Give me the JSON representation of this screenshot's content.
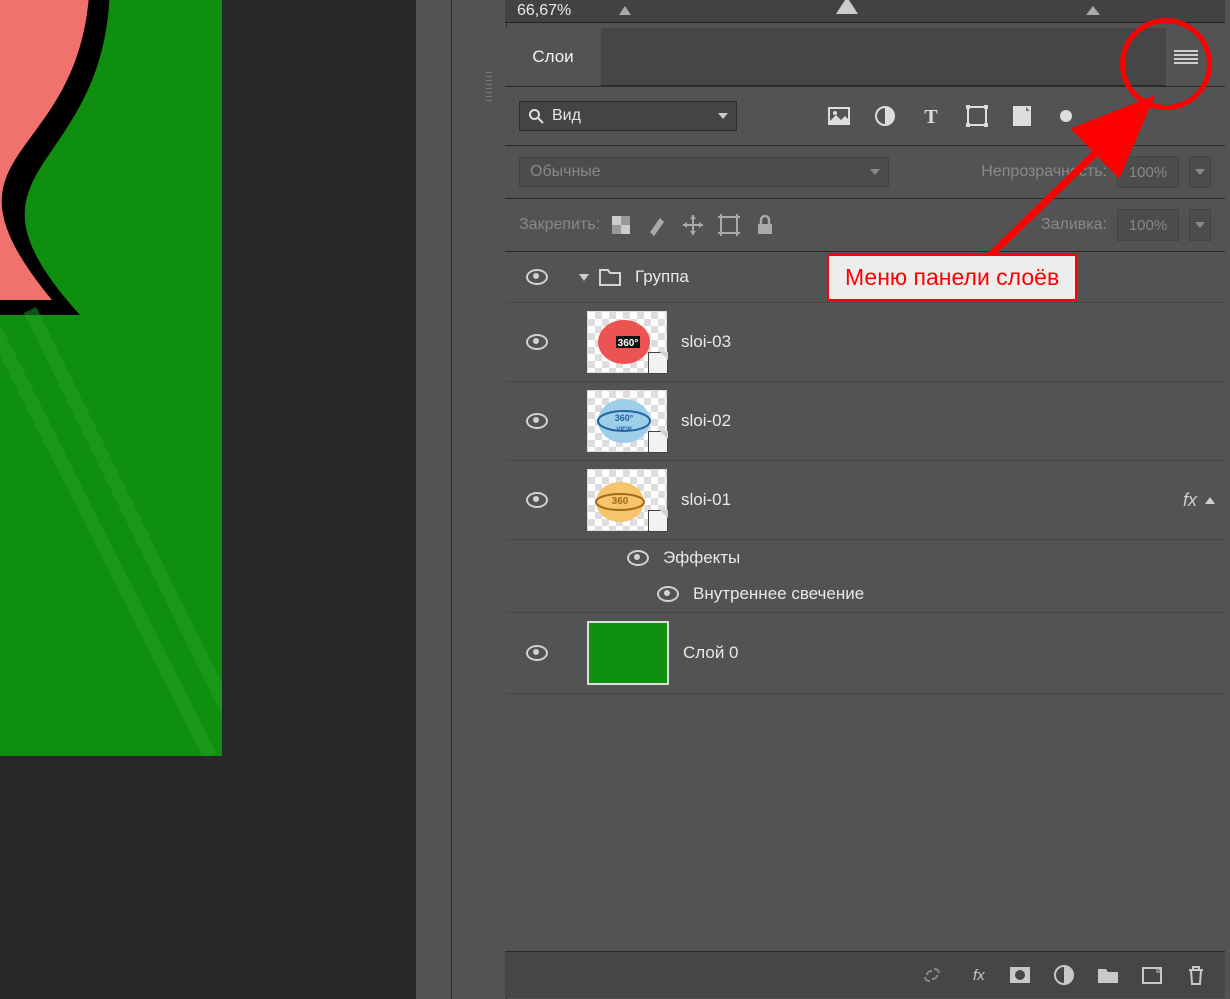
{
  "navigator": {
    "zoom": "66,67%"
  },
  "panel": {
    "tab": "Слои",
    "filter": {
      "mode": "Вид"
    },
    "blend": {
      "mode": "Обычные",
      "opacity_label": "Непрозрачность:",
      "opacity": "100%"
    },
    "lock": {
      "label": "Закрепить:",
      "fill_label": "Заливка:",
      "fill": "100%"
    },
    "group_name": "Группа",
    "layers": [
      {
        "name": "sloi-03"
      },
      {
        "name": "sloi-02"
      },
      {
        "name": "sloi-01"
      }
    ],
    "effects_label": "Эффекты",
    "effect_inner_glow": "Внутреннее свечение",
    "bg_layer": "Слой 0",
    "fx_indicator": "fx"
  },
  "annotation": {
    "label": "Меню панели слоёв"
  },
  "icons": {
    "search": "search-icon",
    "picture": "picture-icon",
    "adjust": "adjustment-icon",
    "type": "type-icon",
    "shape": "shape-icon",
    "smart": "smartobject-icon"
  }
}
